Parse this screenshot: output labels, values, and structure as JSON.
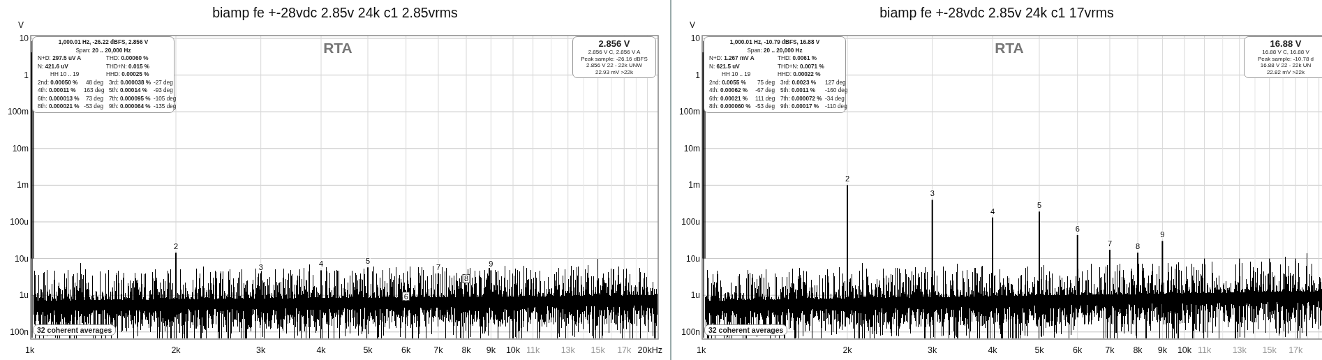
{
  "panels": [
    {
      "title": "biamp fe +-28vdc 2.85v 24k c1 2.85vrms",
      "y_unit": "V",
      "plot_label": "RTA",
      "averages": "32 coherent averages",
      "y_ticks": [
        "10",
        "1",
        "100m",
        "10m",
        "1m",
        "100u",
        "10u",
        "1u",
        "100n"
      ],
      "x_ticks": [
        {
          "label": "1k",
          "minor": false
        },
        {
          "label": "2k",
          "minor": false
        },
        {
          "label": "3k",
          "minor": false
        },
        {
          "label": "4k",
          "minor": false
        },
        {
          "label": "5k",
          "minor": false
        },
        {
          "label": "6k",
          "minor": false
        },
        {
          "label": "7k",
          "minor": false
        },
        {
          "label": "8k",
          "minor": false
        },
        {
          "label": "9k",
          "minor": false
        },
        {
          "label": "10k",
          "minor": false
        },
        {
          "label": "11k",
          "minor": true
        },
        {
          "label": "13k",
          "minor": true
        },
        {
          "label": "15k",
          "minor": true
        },
        {
          "label": "17k",
          "minor": true
        },
        {
          "label": "20kHz",
          "minor": false
        }
      ],
      "summary": {
        "header": "1,000.01 Hz, -26.22 dBFS, 2.856 V",
        "span_label": "Span:",
        "span": "20 .. 20,000 Hz",
        "measurements": [
          {
            "label": "N+D:",
            "value": "297.5 uV A"
          },
          {
            "label": "THD:",
            "value": "0.00060 %"
          },
          {
            "label": "N:",
            "value": "421.6 uV"
          },
          {
            "label": "THD+N:",
            "value": "0.015 %"
          },
          {
            "label": "HH 10 .. 19"
          },
          {
            "label": "HHD:",
            "value": "0.00025 %"
          }
        ],
        "harmonics": [
          {
            "label": "2nd:",
            "value": "0.00050 %",
            "phase": "48 deg"
          },
          {
            "label": "3rd:",
            "value": "0.000038 %",
            "phase": "-27 deg"
          },
          {
            "label": "4th:",
            "value": "0.00011 %",
            "phase": "163 deg"
          },
          {
            "label": "5th:",
            "value": "0.00014 %",
            "phase": "-93 deg"
          },
          {
            "label": "6th:",
            "value": "0.000013 %",
            "phase": "73 deg"
          },
          {
            "label": "7th:",
            "value": "0.000095 %",
            "phase": "-105 deg"
          },
          {
            "label": "8th:",
            "value": "0.000021 %",
            "phase": "-53 deg"
          },
          {
            "label": "9th:",
            "value": "0.000064 %",
            "phase": "-135 deg"
          }
        ]
      },
      "level_box": {
        "reading": "2.856 V",
        "lines": [
          "2.856 V C, 2.856 V A",
          "Peak sample: -26.16 dBFS",
          "2.856 V 22 - 22k UNW",
          "22.93 mV >22k"
        ]
      },
      "harmonic_peaks": [
        {
          "label": "2",
          "boxed": false
        },
        {
          "label": "3",
          "boxed": false
        },
        {
          "label": "4",
          "boxed": false
        },
        {
          "label": "5",
          "boxed": false
        },
        {
          "label": "6",
          "boxed": true
        },
        {
          "label": "7",
          "boxed": false
        },
        {
          "label": "8",
          "boxed": true
        },
        {
          "label": "9",
          "boxed": false
        }
      ]
    },
    {
      "title": "biamp fe +-28vdc 2.85v 24k c1 17vrms",
      "y_unit": "V",
      "plot_label": "RTA",
      "averages": "32 coherent averages",
      "y_ticks": [
        "10",
        "1",
        "100m",
        "10m",
        "1m",
        "100u",
        "10u",
        "1u",
        "100n"
      ],
      "x_ticks": [
        {
          "label": "1k",
          "minor": false
        },
        {
          "label": "2k",
          "minor": false
        },
        {
          "label": "3k",
          "minor": false
        },
        {
          "label": "4k",
          "minor": false
        },
        {
          "label": "5k",
          "minor": false
        },
        {
          "label": "6k",
          "minor": false
        },
        {
          "label": "7k",
          "minor": false
        },
        {
          "label": "8k",
          "minor": false
        },
        {
          "label": "9k",
          "minor": false
        },
        {
          "label": "10k",
          "minor": false
        },
        {
          "label": "11k",
          "minor": true
        },
        {
          "label": "13k",
          "minor": true
        },
        {
          "label": "15k",
          "minor": true
        },
        {
          "label": "17k",
          "minor": true
        }
      ],
      "summary": {
        "header": "1,000.01 Hz, -10.79 dBFS, 16.88 V",
        "span_label": "Span:",
        "span": "20 .. 20,000 Hz",
        "measurements": [
          {
            "label": "N+D:",
            "value": "1.267 mV A"
          },
          {
            "label": "THD:",
            "value": "0.0061 %"
          },
          {
            "label": "N:",
            "value": "621.5 uV"
          },
          {
            "label": "THD+N:",
            "value": "0.0071 %"
          },
          {
            "label": "HH 10 .. 19"
          },
          {
            "label": "HHD:",
            "value": "0.00022 %"
          }
        ],
        "harmonics": [
          {
            "label": "2nd:",
            "value": "0.0055 %",
            "phase": "75 deg"
          },
          {
            "label": "3rd:",
            "value": "0.0023 %",
            "phase": "127 deg"
          },
          {
            "label": "4th:",
            "value": "0.00062 %",
            "phase": "-67 deg"
          },
          {
            "label": "5th:",
            "value": "0.0011 %",
            "phase": "-160 deg"
          },
          {
            "label": "6th:",
            "value": "0.00021 %",
            "phase": "111 deg"
          },
          {
            "label": "7th:",
            "value": "0.000072 %",
            "phase": "-34 deg"
          },
          {
            "label": "8th:",
            "value": "0.000060 %",
            "phase": "-53 deg"
          },
          {
            "label": "9th:",
            "value": "0.00017 %",
            "phase": "-110 deg"
          }
        ]
      },
      "level_box": {
        "reading": "16.88 V",
        "lines": [
          "16.88 V C, 16.88 V",
          "Peak sample: -10.78 d",
          "16.88 V 22 - 22k UN",
          "22.82 mV >22k"
        ]
      },
      "harmonic_peaks": [
        {
          "label": "2",
          "boxed": false
        },
        {
          "label": "3",
          "boxed": false
        },
        {
          "label": "4",
          "boxed": false
        },
        {
          "label": "5",
          "boxed": false
        },
        {
          "label": "6",
          "boxed": false
        },
        {
          "label": "7",
          "boxed": false
        },
        {
          "label": "8",
          "boxed": false
        },
        {
          "label": "9",
          "boxed": false
        }
      ]
    }
  ]
}
